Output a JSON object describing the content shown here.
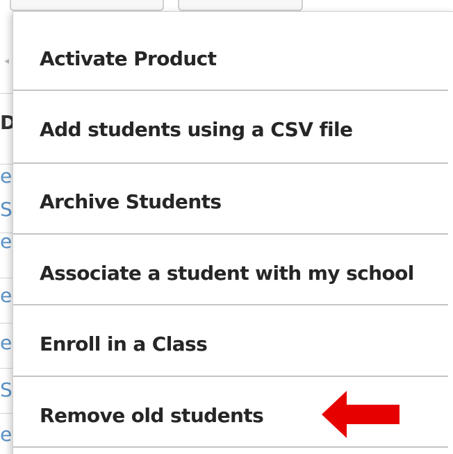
{
  "menu": {
    "items": [
      {
        "label": "Activate Product"
      },
      {
        "label": "Add students using a CSV file"
      },
      {
        "label": "Archive Students"
      },
      {
        "label": "Associate a student with my school"
      },
      {
        "label": "Enroll in a Class"
      },
      {
        "label": "Remove old students"
      }
    ]
  },
  "background": {
    "row_fragments": [
      "D",
      "e",
      "Se",
      "e",
      "e",
      "e",
      "Se",
      "e"
    ]
  },
  "annotation": {
    "arrow_color": "#e60000",
    "arrow_direction": "left",
    "points_to": "Remove old students"
  },
  "colors": {
    "menu_text": "#262626",
    "divider": "#c4c4c4",
    "link_fragment": "#5a93c8"
  }
}
